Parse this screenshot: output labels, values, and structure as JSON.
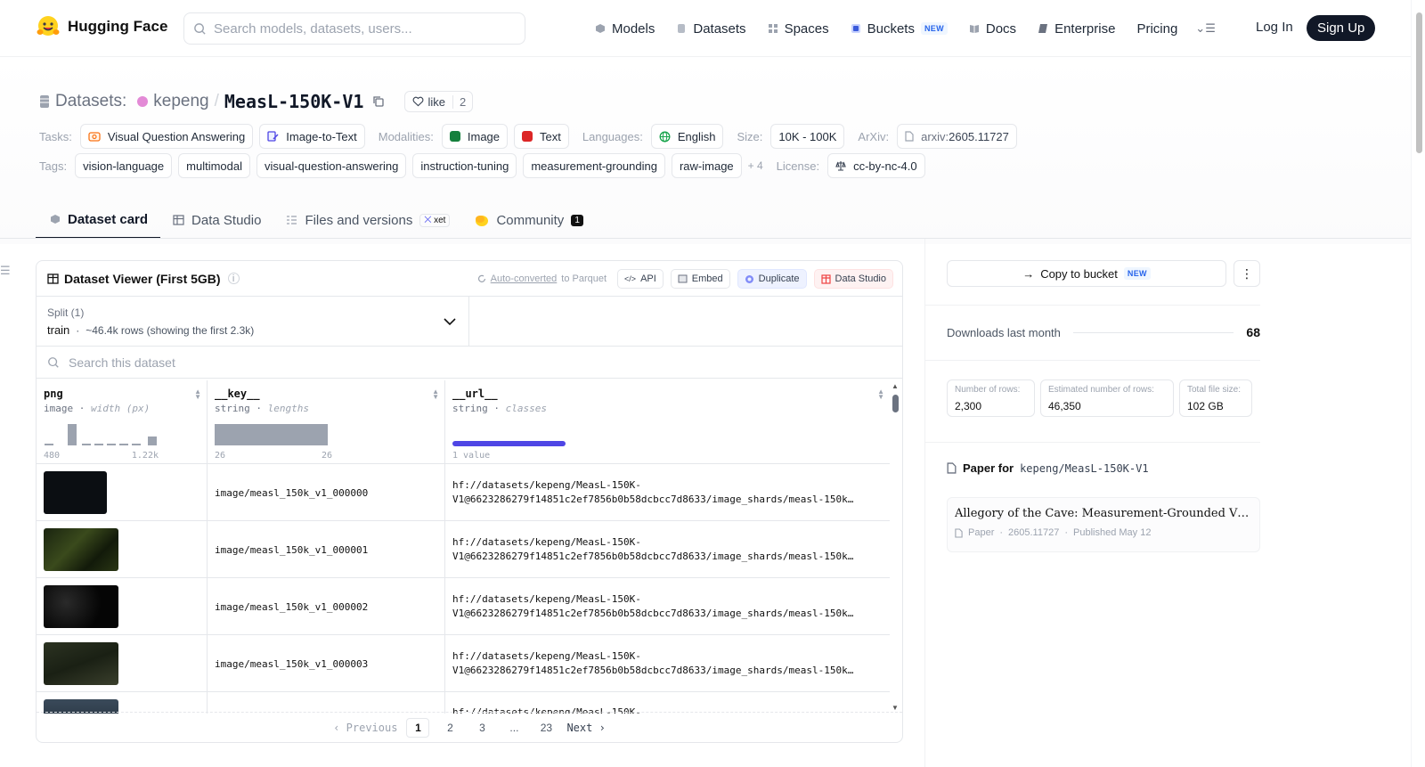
{
  "nav": {
    "brand": "Hugging Face",
    "search_placeholder": "Search models, datasets, users...",
    "links": [
      {
        "label": "Models",
        "icon": "cube-icon",
        "color": "#9ca3af"
      },
      {
        "label": "Datasets",
        "icon": "database-icon",
        "color": "#9ca3af"
      },
      {
        "label": "Spaces",
        "icon": "grid-icon",
        "color": "#9ca3af"
      },
      {
        "label": "Buckets",
        "icon": "bucket-icon",
        "color": "#3b5bdb"
      },
      {
        "label": "Docs",
        "icon": "book-icon",
        "color": "#9ca3af"
      },
      {
        "label": "Enterprise",
        "icon": "enterprise-icon",
        "color": "#6b7280"
      },
      {
        "label": "Pricing"
      }
    ],
    "buckets_badge": "NEW",
    "login": "Log In",
    "signup": "Sign Up"
  },
  "header": {
    "section": "Datasets:",
    "user": "kepeng",
    "repo": "MeasL-150K-V1",
    "like_label": "like",
    "like_count": "2"
  },
  "meta": {
    "tasks_label": "Tasks:",
    "tasks": [
      "Visual Question Answering",
      "Image-to-Text"
    ],
    "modalities_label": "Modalities:",
    "modalities": [
      "Image",
      "Text"
    ],
    "languages_label": "Languages:",
    "language": "English",
    "size_label": "Size:",
    "size": "10K - 100K",
    "arxiv_label": "ArXiv:",
    "arxiv_prefix": "arxiv:",
    "arxiv_id": "2605.11727",
    "tags_label": "Tags:",
    "tags": [
      "vision-language",
      "multimodal",
      "visual-question-answering",
      "instruction-tuning",
      "measurement-grounding",
      "raw-image"
    ],
    "tags_more": "+ 4",
    "license_label": "License:",
    "license": "cc-by-nc-4.0"
  },
  "tabs": {
    "card": "Dataset card",
    "studio": "Data Studio",
    "files": "Files and versions",
    "xet": "xet",
    "community": "Community",
    "community_count": "1"
  },
  "viewer": {
    "title": "Dataset Viewer (First 5GB)",
    "autoconv_link": "Auto-converted",
    "autoconv_rest": "to Parquet",
    "api": "API",
    "embed": "Embed",
    "duplicate": "Duplicate",
    "datastudio": "Data Studio",
    "split_label": "Split (1)",
    "split_name": "train",
    "split_rows": "~46.4k rows (showing the first 2.3k)",
    "search_placeholder": "Search this dataset",
    "columns": [
      {
        "name": "png",
        "type": "image",
        "stat": "width (px)",
        "min": "480",
        "max": "1.22k"
      },
      {
        "name": "__key__",
        "type": "string",
        "stat": "lengths",
        "min": "26",
        "max": "26"
      },
      {
        "name": "__url__",
        "type": "string",
        "stat": "classes",
        "summary": "1 value"
      }
    ],
    "rows": [
      {
        "key": "image/measl_150k_v1_000000",
        "url": "hf://datasets/kepeng/MeasL-150K-\nV1@6623286279f14851c2ef7856b0b58dcbcc7d8633/image_shards/measl-150k…"
      },
      {
        "key": "image/measl_150k_v1_000001",
        "url": "hf://datasets/kepeng/MeasL-150K-\nV1@6623286279f14851c2ef7856b0b58dcbcc7d8633/image_shards/measl-150k…"
      },
      {
        "key": "image/measl_150k_v1_000002",
        "url": "hf://datasets/kepeng/MeasL-150K-\nV1@6623286279f14851c2ef7856b0b58dcbcc7d8633/image_shards/measl-150k…"
      },
      {
        "key": "image/measl_150k_v1_000003",
        "url": "hf://datasets/kepeng/MeasL-150K-\nV1@6623286279f14851c2ef7856b0b58dcbcc7d8633/image_shards/measl-150k…"
      },
      {
        "key": "",
        "url": "hf://datasets/kepeng/MeasL-150K-"
      }
    ],
    "pager": {
      "prev": "Previous",
      "pages": [
        "1",
        "2",
        "3",
        "...",
        "23"
      ],
      "next": "Next"
    }
  },
  "right": {
    "copy": "Copy to bucket",
    "copy_badge": "NEW",
    "downloads_label": "Downloads last month",
    "downloads": "68",
    "stats": [
      {
        "k": "Number of rows:",
        "v": "2,300"
      },
      {
        "k": "Estimated number of rows:",
        "v": "46,350"
      },
      {
        "k": "Total file size:",
        "v": "102 GB"
      }
    ],
    "paper_for": "Paper for",
    "paper_repo": "kepeng/MeasL-150K-V1",
    "paper_title": "Allegory of the Cave: Measurement-Grounded Visi…",
    "paper_kind": "Paper",
    "paper_id": "2605.11727",
    "paper_published": "Published May 12"
  }
}
